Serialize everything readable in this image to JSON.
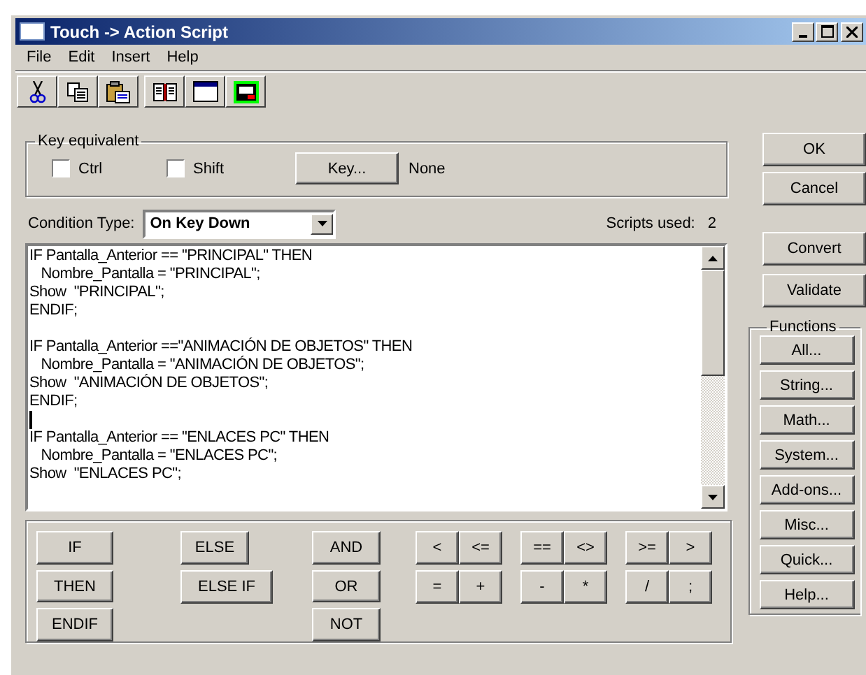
{
  "window": {
    "title": "Touch -> Action Script"
  },
  "menu": [
    "File",
    "Edit",
    "Insert",
    "Help"
  ],
  "toolbar": [
    {
      "kind": "cut"
    },
    {
      "kind": "copy"
    },
    {
      "kind": "paste"
    },
    {
      "kind": "book"
    },
    {
      "kind": "window"
    },
    {
      "kind": "ocx"
    }
  ],
  "key_equivalent": {
    "legend": "Key equivalent",
    "checkboxes": [
      {
        "label": "Ctrl",
        "checked": false
      },
      {
        "label": "Shift",
        "checked": false
      }
    ],
    "key_button": "Key...",
    "key_value": "None"
  },
  "condition": {
    "label": "Condition Type:",
    "value": "On Key Down"
  },
  "scripts_used": {
    "label": "Scripts used:",
    "value": "2"
  },
  "script_blocks": [
    {
      "lines": [
        "IF Pantalla_Anterior == \"PRINCIPAL\" THEN",
        "   Nombre_Pantalla = \"PRINCIPAL\";",
        "Show  \"PRINCIPAL\";",
        "ENDIF;"
      ],
      "caret_after": false
    },
    {
      "lines": [
        "IF Pantalla_Anterior ==\"ANIMACIÓN DE OBJETOS\" THEN",
        "   Nombre_Pantalla = \"ANIMACIÓN DE OBJETOS\";",
        "Show  \"ANIMACIÓN DE OBJETOS\";",
        "ENDIF;"
      ],
      "caret_after": true
    },
    {
      "lines": [
        "IF Pantalla_Anterior == \"ENLACES PC\" THEN",
        "   Nombre_Pantalla = \"ENLACES PC\";",
        "Show  \"ENLACES PC\";"
      ],
      "caret_after": false
    }
  ],
  "keyword_columns": [
    [
      "IF",
      "THEN",
      "ENDIF"
    ],
    [
      "ELSE",
      "ELSE IF"
    ],
    [
      "AND",
      "OR",
      "NOT"
    ]
  ],
  "operator_groups": [
    [
      "<",
      "<=",
      "=",
      "+"
    ],
    [
      "==",
      "<>",
      "-",
      "*"
    ],
    [
      ">=",
      ">",
      "/",
      ";"
    ]
  ],
  "side_buttons": [
    "OK",
    "Cancel",
    "Convert",
    "Validate"
  ],
  "functions": {
    "legend": "Functions",
    "buttons": [
      "All...",
      "String...",
      "Math...",
      "System...",
      "Add-ons...",
      "Misc...",
      "Quick...",
      "Help..."
    ]
  }
}
